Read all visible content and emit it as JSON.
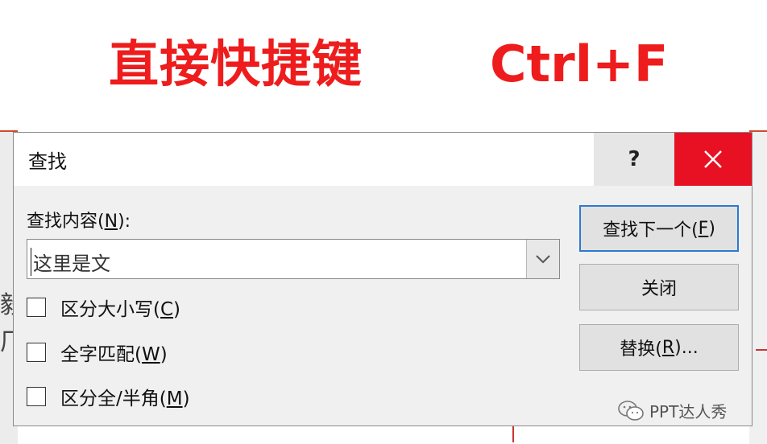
{
  "headline": {
    "left": "直接快捷键",
    "right": "Ctrl+F",
    "color": "#ee1c1c"
  },
  "background": {
    "left_fragments": [
      "毅",
      "厂"
    ]
  },
  "dialog": {
    "title": "查找",
    "help_label": "?",
    "close_icon": "close-icon",
    "find_label_prefix": "查找内容(",
    "find_label_key": "N",
    "find_label_suffix": "):",
    "find_value": "这里是文",
    "options": [
      {
        "prefix": "区分大小写(",
        "key": "C",
        "suffix": ")",
        "checked": false
      },
      {
        "prefix": "全字匹配(",
        "key": "W",
        "suffix": ")",
        "checked": false
      },
      {
        "prefix": "区分全/半角(",
        "key": "M",
        "suffix": ")",
        "checked": false
      }
    ],
    "buttons": {
      "find_next": {
        "prefix": "查找下一个(",
        "key": "F",
        "suffix": ")"
      },
      "close": "关闭",
      "replace": {
        "prefix": "替换(",
        "key": "R",
        "suffix": ")..."
      }
    },
    "accent": "#2b7ad2",
    "close_color": "#e81123"
  },
  "watermark": {
    "icon": "wechat-icon",
    "text": "PPT达人秀"
  }
}
